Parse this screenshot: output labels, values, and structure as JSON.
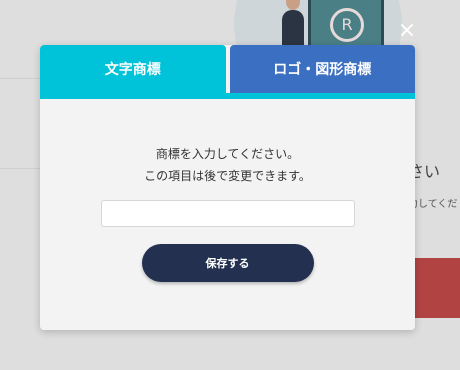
{
  "background": {
    "side_heading": "さい",
    "side_text": "力してくだ",
    "board_mark": "R"
  },
  "close_label": "×",
  "tabs": [
    {
      "label": "文字商標",
      "active": true,
      "color": "#00c2d9"
    },
    {
      "label": "ロゴ・図形商標",
      "active": false,
      "color": "#3b6fc2"
    }
  ],
  "instructions": {
    "line1": "商標を入力してください。",
    "line2": "この項目は後で変更できます。"
  },
  "input": {
    "value": "",
    "placeholder": ""
  },
  "save_button": {
    "label": "保存する",
    "color": "#24304f"
  }
}
